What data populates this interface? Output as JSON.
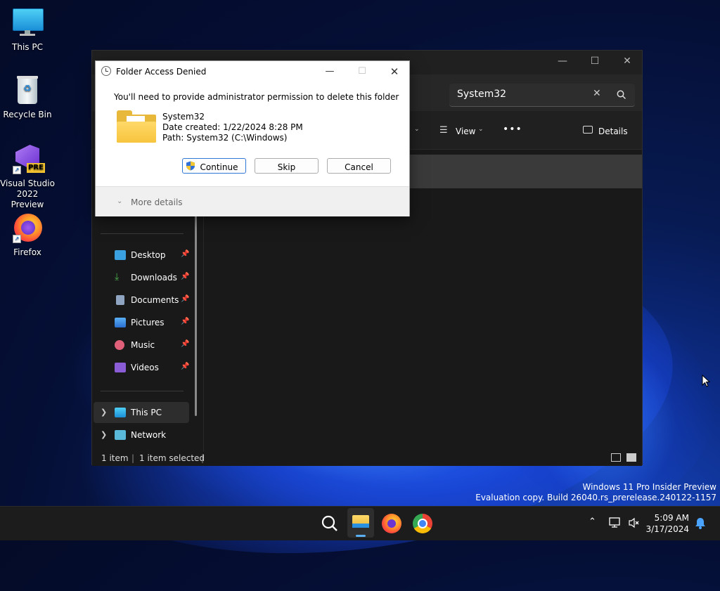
{
  "desktop": {
    "icons": [
      {
        "label": "This PC"
      },
      {
        "label": "Recycle Bin"
      },
      {
        "label": "Visual Studio 2022 Preview",
        "line1": "Visual Studio",
        "line2": "2022 Preview",
        "badge": "PRE"
      },
      {
        "label": "Firefox"
      }
    ]
  },
  "explorer": {
    "search_value": "System32",
    "toolbar": {
      "view_label": "View",
      "details_label": "Details",
      "more_label": "•••"
    },
    "nav": {
      "quick_access": [
        {
          "label": "Desktop",
          "color": "#3aa0e0"
        },
        {
          "label": "Downloads",
          "color": "#4caf50"
        },
        {
          "label": "Documents",
          "color": "#8fa4c0"
        },
        {
          "label": "Pictures",
          "color": "#3d8fe0"
        },
        {
          "label": "Music",
          "color": "#e0607a"
        },
        {
          "label": "Videos",
          "color": "#8a5cd6"
        }
      ],
      "this_pc": "This PC",
      "network": "Network"
    },
    "status": {
      "count": "1 item",
      "selected": "1 item selected"
    }
  },
  "dialog": {
    "title": "Folder Access Denied",
    "message": "You'll need to provide administrator permission to delete this folder",
    "folder_name": "System32",
    "date_created": "Date created: 1/22/2024 8:28 PM",
    "path": "Path: System32 (C:\\Windows)",
    "buttons": {
      "continue": "Continue",
      "skip": "Skip",
      "cancel": "Cancel"
    },
    "more_details": "More details"
  },
  "watermark": {
    "line1": "Windows 11 Pro Insider Preview",
    "line2": "Evaluation copy. Build 26040.rs_prerelease.240122-1157"
  },
  "taskbar": {
    "time": "5:09 AM",
    "date": "3/17/2024"
  }
}
